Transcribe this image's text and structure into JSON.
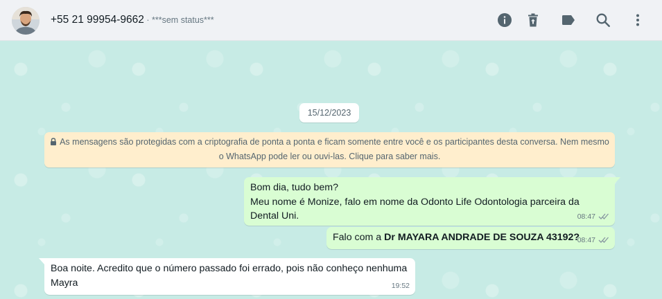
{
  "header": {
    "contact_name": "+55 21 99954-9662",
    "separator": " · ",
    "status": "***sem status***",
    "icons": [
      "info-icon",
      "delete-icon",
      "label-icon",
      "search-icon",
      "more-icon"
    ]
  },
  "chat": {
    "date_chip": "15/12/2023",
    "encryption_notice": {
      "line1": "As mensagens são protegidas com a criptografia de ponta a ponta e ficam somente entre você e os participantes desta conversa. Nem mesmo",
      "line2": "o WhatsApp pode ler ou ouvi-las. Clique para saber mais."
    },
    "messages": [
      {
        "direction": "outgoing",
        "lines": [
          "Bom dia, tudo bem?",
          "Meu nome é Monize, falo em nome da Odonto Life Odontologia parceira da",
          "Dental Uni."
        ],
        "time": "08:47",
        "status": "read"
      },
      {
        "direction": "outgoing",
        "prefix": "Falo com a ",
        "bold": "Dr MAYARA ANDRADE DE SOUZA 43192?",
        "time": "08:47",
        "status": "read"
      },
      {
        "direction": "incoming",
        "lines": [
          "Boa noite. Acredito que o número passado foi errado, pois não conheço nenhuma",
          "Mayra"
        ],
        "time": "19:52"
      }
    ]
  },
  "colors": {
    "header_bg": "#f0f2f5",
    "chat_bg": "#c7ebe5",
    "outgoing_bubble": "#d9fdd3",
    "incoming_bubble": "#ffffff",
    "encryption_bg": "#ffeecd",
    "icon": "#54656f",
    "tick": "#8696a0"
  }
}
